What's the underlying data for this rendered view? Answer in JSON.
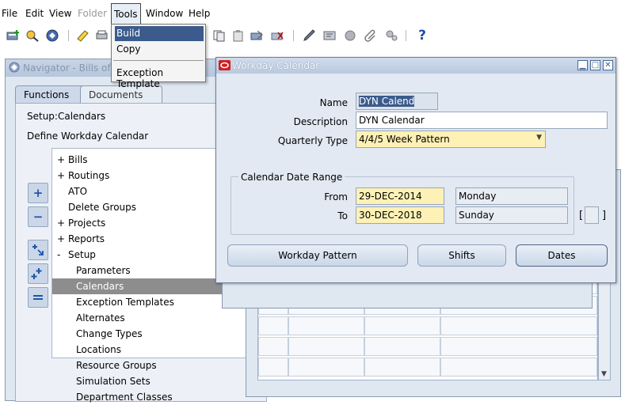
{
  "menubar": {
    "file": "File",
    "edit": "Edit",
    "view": "View",
    "folder": "Folder",
    "tools": "Tools",
    "window": "Window",
    "help": "Help"
  },
  "toolbar": {
    "help_glyph": "?"
  },
  "tools_menu": {
    "items": [
      "Build",
      "Copy",
      "Exception Template"
    ]
  },
  "navigator": {
    "title": "Navigator - Bills of M",
    "tabs": [
      "Functions",
      "Documents"
    ],
    "breadcrumb": "Setup:Calendars",
    "description": "Define Workday Calendar",
    "tree": [
      {
        "marker": "+",
        "label": "Bills"
      },
      {
        "marker": "+",
        "label": "Routings"
      },
      {
        "marker": "",
        "label": "ATO"
      },
      {
        "marker": "",
        "label": "Delete Groups"
      },
      {
        "marker": "+",
        "label": "Projects"
      },
      {
        "marker": "+",
        "label": "Reports"
      },
      {
        "marker": "-",
        "label": "Setup"
      },
      {
        "marker": "",
        "label": "Parameters"
      },
      {
        "marker": "",
        "label": "Calendars"
      },
      {
        "marker": "",
        "label": "Exception Templates"
      },
      {
        "marker": "",
        "label": "Alternates"
      },
      {
        "marker": "",
        "label": "Change Types"
      },
      {
        "marker": "",
        "label": "Locations"
      },
      {
        "marker": "",
        "label": "Resource Groups"
      },
      {
        "marker": "",
        "label": "Simulation Sets"
      },
      {
        "marker": "",
        "label": "Department Classes"
      }
    ]
  },
  "workday_calendar": {
    "title": "Workday Calendar",
    "name_label": "Name",
    "name_value": "DYN Calend",
    "description_label": "Description",
    "description_value": "DYN Calendar",
    "quarterly_type_label": "Quarterly Type",
    "quarterly_type_value": "4/4/5 Week Pattern",
    "range_title": "Calendar Date Range",
    "from_label": "From",
    "from_date": "29-DEC-2014",
    "from_day": "Monday",
    "to_label": "To",
    "to_date": "30-DEC-2018",
    "to_day": "Sunday",
    "bracket_open": "[",
    "bracket_close": "]",
    "buttons": {
      "workday_pattern": "Workday Pattern",
      "shifts": "Shifts",
      "dates": "Dates"
    }
  },
  "colors": {
    "selection": "#3a5b8c",
    "required_field": "#fdf1b5",
    "window_bg": "#e2e9f3",
    "tree_selected": "#8d8d8d"
  }
}
